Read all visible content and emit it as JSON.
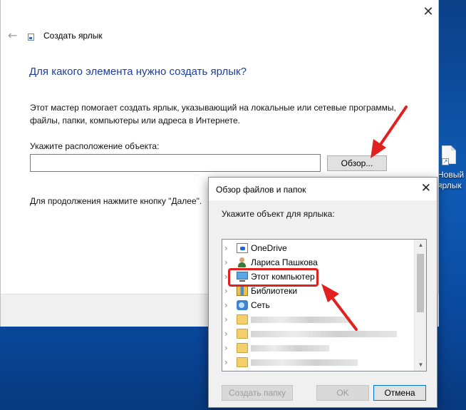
{
  "wizard": {
    "window_title": "Создать ярлык",
    "heading": "Для какого элемента нужно создать ярлык?",
    "description": "Этот мастер помогает создать ярлык, указывающий на локальные или сетевые программы, файлы, папки, компьютеры или адреса в Интернете.",
    "location_label": "Укажите расположение объекта:",
    "location_value": "",
    "browse_label": "Обзор...",
    "continue_text": "Для продолжения нажмите кнопку \"Далее\".",
    "close_glyph": "✕",
    "back_glyph": "←"
  },
  "desktop": {
    "icon_label": "Новый ярлык",
    "icon_name": "new-shortcut-icon"
  },
  "browse_dialog": {
    "title": "Обзор файлов и папок",
    "close_glyph": "✕",
    "prompt": "Укажите объект для ярлыка:",
    "tree": [
      {
        "label": "OneDrive",
        "icon": "onedrive-icon"
      },
      {
        "label": "Лариса Пашкова",
        "icon": "user-icon"
      },
      {
        "label": "Этот компьютер",
        "icon": "computer-icon",
        "highlighted": true
      },
      {
        "label": "Библиотеки",
        "icon": "libraries-icon"
      },
      {
        "label": "Сеть",
        "icon": "network-icon"
      },
      {
        "label": "",
        "icon": "folder-icon"
      },
      {
        "label": "",
        "icon": "folder-icon"
      },
      {
        "label": "",
        "icon": "folder-icon"
      },
      {
        "label": "",
        "icon": "folder-icon"
      },
      {
        "label": "",
        "icon": "folder-icon"
      }
    ],
    "buttons": {
      "new_folder": "Создать папку",
      "ok": "OK",
      "cancel": "Отмена"
    }
  },
  "annotation_color": "#e0211f"
}
